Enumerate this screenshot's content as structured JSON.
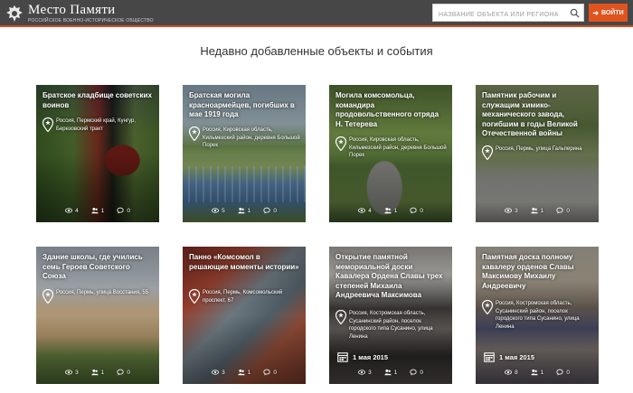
{
  "header": {
    "logo_title": "Место Памяти",
    "logo_subtitle": "РОССИЙСКОЕ ВОЕННО-ИСТОРИЧЕСКОЕ ОБЩЕСТВО",
    "search_placeholder": "название объекта или региона",
    "login_label": "ВОЙТИ"
  },
  "section_title": "Недавно добавленные объекты и события",
  "cards": [
    {
      "title": "Братское кладбище советских воинов",
      "location": "Россия, Пермский край, Кунгур, Березовский тракт",
      "views": "4",
      "likes": "1",
      "comments": "0"
    },
    {
      "title": "Братская могила красноармейцев, погибших в мае 1919 года",
      "location": "Россия, Кировская область, Кильмезский район, деревня Большой Порек",
      "views": "5",
      "likes": "1",
      "comments": "0"
    },
    {
      "title": "Могила комсомольца, командира продовольственного отряда Н. Тетерева",
      "location": "Россия, Кировская область, Кильмезский район, деревня Большой Порек",
      "views": "4",
      "likes": "1",
      "comments": "0"
    },
    {
      "title": "Памятник рабочим и служащим химико-механического завода, погибшим в годы Великой Отечественной войны",
      "location": "Россия, Пермь, улица Гальперина",
      "views": "3",
      "likes": "1",
      "comments": "0"
    },
    {
      "title": "Здание школы, где учились семь Героев Советского Союза",
      "location": "Россия, Пермь, улица Восстания, 55",
      "views": "3",
      "likes": "1",
      "comments": "0"
    },
    {
      "title": "Панно «Комсомол в решающие моменты истории»",
      "location": "Россия, Пермь, Комсомольский проспект, 67",
      "views": "3",
      "likes": "1",
      "comments": "0"
    },
    {
      "title": "Открытие памятной мемориальной доски Кавалера Ордена Славы трех степеней Михаила Андреевича Максимова",
      "location": "Россия, Костромская область, Сусанинский район, поселок городского типа Сусанино, улица Ленина",
      "date": "1 мая 2015",
      "views": "3",
      "likes": "1",
      "comments": "0"
    },
    {
      "title": "Памятная доска полному кавалеру орденов Славы Максимову Михаилу Андреевичу",
      "location": "Россия, Костромская область, Сусанинский район, поселок городского типа Сусанино, улица Ленина",
      "date": "1 мая 2015",
      "views": "8",
      "likes": "1",
      "comments": "0"
    }
  ],
  "colors": {
    "header_bg": "#474747",
    "accent": "#e0531f"
  }
}
